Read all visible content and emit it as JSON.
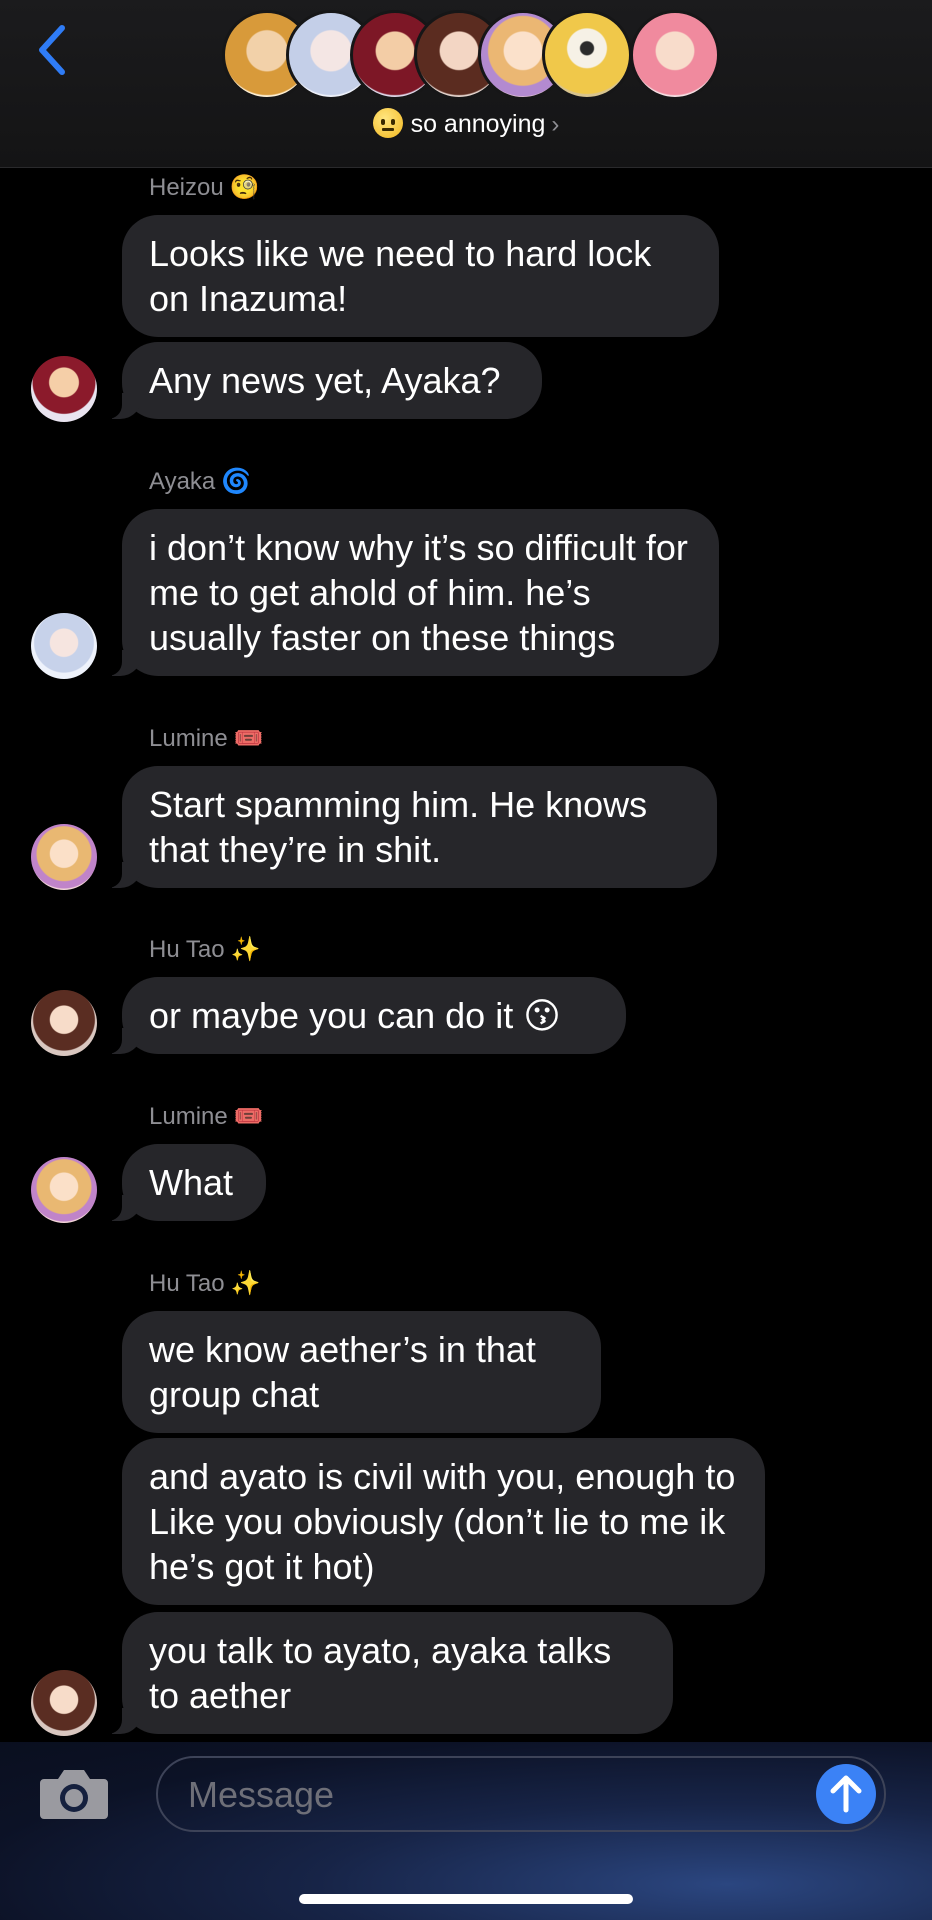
{
  "header": {
    "group_emoji": "neutral-face-emoji",
    "group_name": "so annoying",
    "chevron": "›",
    "member_avatars": [
      "avatar-1",
      "avatar-2",
      "avatar-3",
      "avatar-4",
      "avatar-5",
      "avatar-6",
      "avatar-7"
    ]
  },
  "messages": [
    {
      "sender": "Heizou",
      "tag": "🧐"
    },
    {
      "text": "Looks like we need to hard lock on Inazuma!"
    },
    {
      "text": "Any news yet, Ayaka?"
    },
    {
      "sender": "Ayaka",
      "tag": "🌀"
    },
    {
      "text": "i don’t know why it’s so difficult for me to get ahold of him. he’s usually faster on these things"
    },
    {
      "sender": "Lumine",
      "tag": "🎟️"
    },
    {
      "text": "Start spamming him. He knows that they’re in shit."
    },
    {
      "sender": "Hu Tao",
      "tag": "✨"
    },
    {
      "text": "or maybe you can do it 😗"
    },
    {
      "sender": "Lumine",
      "tag": "🎟️"
    },
    {
      "text": "What"
    },
    {
      "sender": "Hu Tao",
      "tag": "✨"
    },
    {
      "text": "we know aether’s in that group chat"
    },
    {
      "text": "and ayato is civil with you, enough to Like you obviously (don’t lie to me ik he’s got it hot)"
    },
    {
      "text": "you talk to ayato, ayaka talks to aether"
    }
  ],
  "composer": {
    "placeholder": "Message"
  },
  "colors": {
    "accent": "#3b82f6",
    "bubble": "#26262a",
    "background": "#000000"
  }
}
